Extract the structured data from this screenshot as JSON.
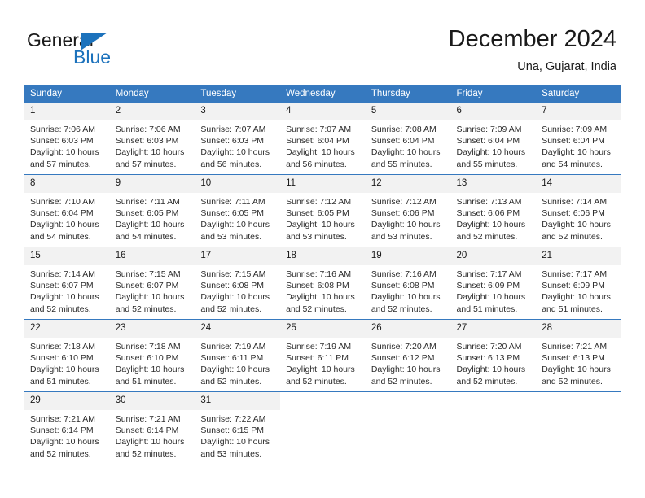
{
  "brand": {
    "name_top": "General",
    "name_bottom": "Blue",
    "accent_color": "#1c72bc"
  },
  "header": {
    "title": "December 2024",
    "subtitle": "Una, Gujarat, India"
  },
  "theme": {
    "header_row_bg": "#3679bf",
    "daynum_bg": "#f2f2f2",
    "grid_line": "#3679bf",
    "text": "#1a1a1a"
  },
  "weekday_headers": [
    "Sunday",
    "Monday",
    "Tuesday",
    "Wednesday",
    "Thursday",
    "Friday",
    "Saturday"
  ],
  "weeks": [
    [
      {
        "day": "1",
        "sunrise": "Sunrise: 7:06 AM",
        "sunset": "Sunset: 6:03 PM",
        "daylight_line1": "Daylight: 10 hours",
        "daylight_line2": "and 57 minutes."
      },
      {
        "day": "2",
        "sunrise": "Sunrise: 7:06 AM",
        "sunset": "Sunset: 6:03 PM",
        "daylight_line1": "Daylight: 10 hours",
        "daylight_line2": "and 57 minutes."
      },
      {
        "day": "3",
        "sunrise": "Sunrise: 7:07 AM",
        "sunset": "Sunset: 6:03 PM",
        "daylight_line1": "Daylight: 10 hours",
        "daylight_line2": "and 56 minutes."
      },
      {
        "day": "4",
        "sunrise": "Sunrise: 7:07 AM",
        "sunset": "Sunset: 6:04 PM",
        "daylight_line1": "Daylight: 10 hours",
        "daylight_line2": "and 56 minutes."
      },
      {
        "day": "5",
        "sunrise": "Sunrise: 7:08 AM",
        "sunset": "Sunset: 6:04 PM",
        "daylight_line1": "Daylight: 10 hours",
        "daylight_line2": "and 55 minutes."
      },
      {
        "day": "6",
        "sunrise": "Sunrise: 7:09 AM",
        "sunset": "Sunset: 6:04 PM",
        "daylight_line1": "Daylight: 10 hours",
        "daylight_line2": "and 55 minutes."
      },
      {
        "day": "7",
        "sunrise": "Sunrise: 7:09 AM",
        "sunset": "Sunset: 6:04 PM",
        "daylight_line1": "Daylight: 10 hours",
        "daylight_line2": "and 54 minutes."
      }
    ],
    [
      {
        "day": "8",
        "sunrise": "Sunrise: 7:10 AM",
        "sunset": "Sunset: 6:04 PM",
        "daylight_line1": "Daylight: 10 hours",
        "daylight_line2": "and 54 minutes."
      },
      {
        "day": "9",
        "sunrise": "Sunrise: 7:11 AM",
        "sunset": "Sunset: 6:05 PM",
        "daylight_line1": "Daylight: 10 hours",
        "daylight_line2": "and 54 minutes."
      },
      {
        "day": "10",
        "sunrise": "Sunrise: 7:11 AM",
        "sunset": "Sunset: 6:05 PM",
        "daylight_line1": "Daylight: 10 hours",
        "daylight_line2": "and 53 minutes."
      },
      {
        "day": "11",
        "sunrise": "Sunrise: 7:12 AM",
        "sunset": "Sunset: 6:05 PM",
        "daylight_line1": "Daylight: 10 hours",
        "daylight_line2": "and 53 minutes."
      },
      {
        "day": "12",
        "sunrise": "Sunrise: 7:12 AM",
        "sunset": "Sunset: 6:06 PM",
        "daylight_line1": "Daylight: 10 hours",
        "daylight_line2": "and 53 minutes."
      },
      {
        "day": "13",
        "sunrise": "Sunrise: 7:13 AM",
        "sunset": "Sunset: 6:06 PM",
        "daylight_line1": "Daylight: 10 hours",
        "daylight_line2": "and 52 minutes."
      },
      {
        "day": "14",
        "sunrise": "Sunrise: 7:14 AM",
        "sunset": "Sunset: 6:06 PM",
        "daylight_line1": "Daylight: 10 hours",
        "daylight_line2": "and 52 minutes."
      }
    ],
    [
      {
        "day": "15",
        "sunrise": "Sunrise: 7:14 AM",
        "sunset": "Sunset: 6:07 PM",
        "daylight_line1": "Daylight: 10 hours",
        "daylight_line2": "and 52 minutes."
      },
      {
        "day": "16",
        "sunrise": "Sunrise: 7:15 AM",
        "sunset": "Sunset: 6:07 PM",
        "daylight_line1": "Daylight: 10 hours",
        "daylight_line2": "and 52 minutes."
      },
      {
        "day": "17",
        "sunrise": "Sunrise: 7:15 AM",
        "sunset": "Sunset: 6:08 PM",
        "daylight_line1": "Daylight: 10 hours",
        "daylight_line2": "and 52 minutes."
      },
      {
        "day": "18",
        "sunrise": "Sunrise: 7:16 AM",
        "sunset": "Sunset: 6:08 PM",
        "daylight_line1": "Daylight: 10 hours",
        "daylight_line2": "and 52 minutes."
      },
      {
        "day": "19",
        "sunrise": "Sunrise: 7:16 AM",
        "sunset": "Sunset: 6:08 PM",
        "daylight_line1": "Daylight: 10 hours",
        "daylight_line2": "and 52 minutes."
      },
      {
        "day": "20",
        "sunrise": "Sunrise: 7:17 AM",
        "sunset": "Sunset: 6:09 PM",
        "daylight_line1": "Daylight: 10 hours",
        "daylight_line2": "and 51 minutes."
      },
      {
        "day": "21",
        "sunrise": "Sunrise: 7:17 AM",
        "sunset": "Sunset: 6:09 PM",
        "daylight_line1": "Daylight: 10 hours",
        "daylight_line2": "and 51 minutes."
      }
    ],
    [
      {
        "day": "22",
        "sunrise": "Sunrise: 7:18 AM",
        "sunset": "Sunset: 6:10 PM",
        "daylight_line1": "Daylight: 10 hours",
        "daylight_line2": "and 51 minutes."
      },
      {
        "day": "23",
        "sunrise": "Sunrise: 7:18 AM",
        "sunset": "Sunset: 6:10 PM",
        "daylight_line1": "Daylight: 10 hours",
        "daylight_line2": "and 51 minutes."
      },
      {
        "day": "24",
        "sunrise": "Sunrise: 7:19 AM",
        "sunset": "Sunset: 6:11 PM",
        "daylight_line1": "Daylight: 10 hours",
        "daylight_line2": "and 52 minutes."
      },
      {
        "day": "25",
        "sunrise": "Sunrise: 7:19 AM",
        "sunset": "Sunset: 6:11 PM",
        "daylight_line1": "Daylight: 10 hours",
        "daylight_line2": "and 52 minutes."
      },
      {
        "day": "26",
        "sunrise": "Sunrise: 7:20 AM",
        "sunset": "Sunset: 6:12 PM",
        "daylight_line1": "Daylight: 10 hours",
        "daylight_line2": "and 52 minutes."
      },
      {
        "day": "27",
        "sunrise": "Sunrise: 7:20 AM",
        "sunset": "Sunset: 6:13 PM",
        "daylight_line1": "Daylight: 10 hours",
        "daylight_line2": "and 52 minutes."
      },
      {
        "day": "28",
        "sunrise": "Sunrise: 7:21 AM",
        "sunset": "Sunset: 6:13 PM",
        "daylight_line1": "Daylight: 10 hours",
        "daylight_line2": "and 52 minutes."
      }
    ],
    [
      {
        "day": "29",
        "sunrise": "Sunrise: 7:21 AM",
        "sunset": "Sunset: 6:14 PM",
        "daylight_line1": "Daylight: 10 hours",
        "daylight_line2": "and 52 minutes."
      },
      {
        "day": "30",
        "sunrise": "Sunrise: 7:21 AM",
        "sunset": "Sunset: 6:14 PM",
        "daylight_line1": "Daylight: 10 hours",
        "daylight_line2": "and 52 minutes."
      },
      {
        "day": "31",
        "sunrise": "Sunrise: 7:22 AM",
        "sunset": "Sunset: 6:15 PM",
        "daylight_line1": "Daylight: 10 hours",
        "daylight_line2": "and 53 minutes."
      },
      {
        "day": "",
        "sunrise": "",
        "sunset": "",
        "daylight_line1": "",
        "daylight_line2": ""
      },
      {
        "day": "",
        "sunrise": "",
        "sunset": "",
        "daylight_line1": "",
        "daylight_line2": ""
      },
      {
        "day": "",
        "sunrise": "",
        "sunset": "",
        "daylight_line1": "",
        "daylight_line2": ""
      },
      {
        "day": "",
        "sunrise": "",
        "sunset": "",
        "daylight_line1": "",
        "daylight_line2": ""
      }
    ]
  ]
}
